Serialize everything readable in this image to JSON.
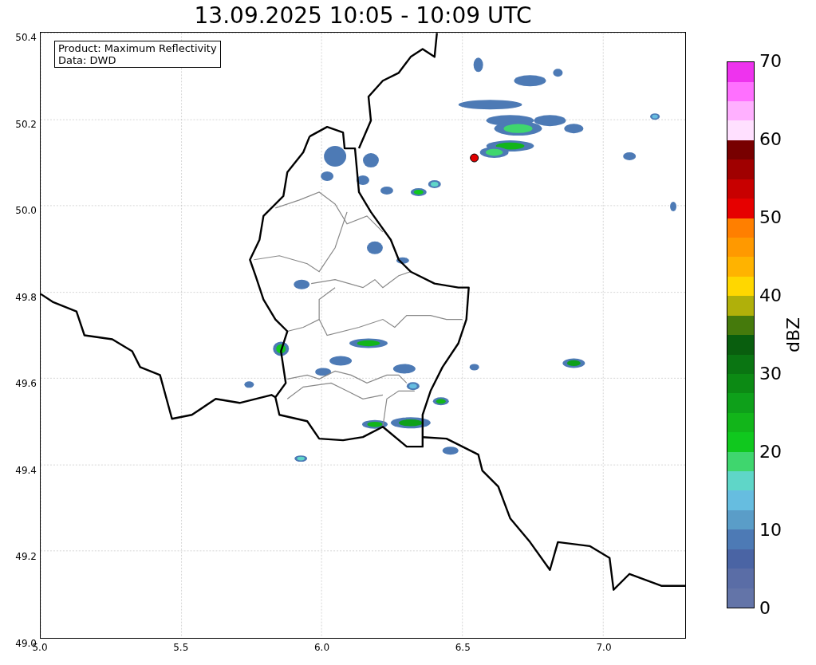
{
  "title": "13.09.2025 10:05 - 10:09 UTC",
  "map": {
    "info": [
      "Product: Maximum Reflectivity",
      "Data: DWD"
    ],
    "xticks": [
      "5.0",
      "5.5",
      "6.0",
      "6.5",
      "7.0"
    ],
    "yticks": [
      "50.4",
      "50.2",
      "50.0",
      "49.8",
      "49.6",
      "49.4",
      "49.2",
      "49.0"
    ]
  },
  "colorbar": {
    "label": "dBZ",
    "ticks": [
      "70",
      "60",
      "50",
      "40",
      "30",
      "20",
      "10",
      "0"
    ],
    "segments": [
      {
        "color": "#6374a8"
      },
      {
        "color": "#5a6da6"
      },
      {
        "color": "#4a64a4"
      },
      {
        "color": "#4d7ab5"
      },
      {
        "color": "#5a9dc8"
      },
      {
        "color": "#66bde0"
      },
      {
        "color": "#5fd6c8"
      },
      {
        "color": "#3fd66e"
      },
      {
        "color": "#10c81e"
      },
      {
        "color": "#12b51a"
      },
      {
        "color": "#0ea01a"
      },
      {
        "color": "#0c8a14"
      },
      {
        "color": "#0a7512"
      },
      {
        "color": "#095e0e"
      },
      {
        "color": "#457a0c"
      },
      {
        "color": "#b0b00a"
      },
      {
        "color": "#ffd700"
      },
      {
        "color": "#ffb300"
      },
      {
        "color": "#ff9900"
      },
      {
        "color": "#ff7f00"
      },
      {
        "color": "#e60000"
      },
      {
        "color": "#c80000"
      },
      {
        "color": "#a00000"
      },
      {
        "color": "#780000"
      },
      {
        "color": "#ffe0ff"
      },
      {
        "color": "#ffb0ff"
      },
      {
        "color": "#ff70ff"
      },
      {
        "color": "#ee33ee"
      }
    ]
  }
}
